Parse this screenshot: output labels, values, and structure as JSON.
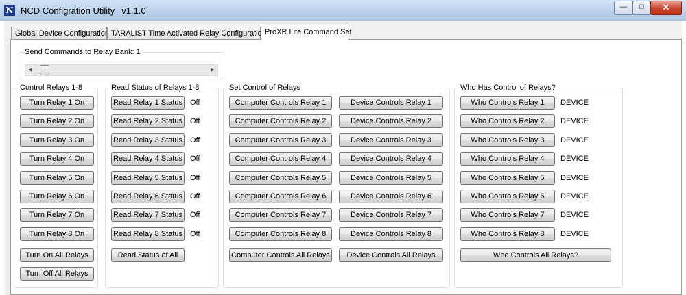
{
  "window": {
    "title": "NCD Configration Utility",
    "version": "v1.1.0",
    "minimize": "—",
    "maximize": "□",
    "close": "✕"
  },
  "tabs": [
    {
      "label": "Global Device Configuration",
      "active": false
    },
    {
      "label": "TARALIST Time Activated Relay Configuration",
      "active": false
    },
    {
      "label": "ProXR Lite Command Set",
      "active": true
    }
  ],
  "bank": {
    "title": "Send Commands to Relay Bank: 1",
    "value": 1,
    "min": 1,
    "max": 32,
    "left_arrow": "◀",
    "right_arrow": "▶"
  },
  "control": {
    "title": "Control Relays 1-8",
    "buttons": [
      "Turn Relay 1 On",
      "Turn Relay 2 On",
      "Turn Relay 3 On",
      "Turn Relay 4 On",
      "Turn Relay 5 On",
      "Turn Relay 6 On",
      "Turn Relay 7 On",
      "Turn Relay 8 On"
    ],
    "all_on": "Turn On All Relays",
    "all_off": "Turn Off All Relays"
  },
  "status": {
    "title": "Read Status of Relays 1-8",
    "buttons": [
      "Read Relay 1 Status",
      "Read Relay 2 Status",
      "Read Relay 3 Status",
      "Read Relay 4 Status",
      "Read Relay 5 Status",
      "Read Relay 6 Status",
      "Read Relay 7 Status",
      "Read Relay 8 Status"
    ],
    "values": [
      "Off",
      "Off",
      "Off",
      "Off",
      "Off",
      "Off",
      "Off",
      "Off"
    ],
    "all": "Read Status of All"
  },
  "set_control": {
    "title": "Set Control of Relays",
    "computer": [
      "Computer Controls Relay 1",
      "Computer Controls Relay 2",
      "Computer Controls Relay 3",
      "Computer Controls Relay 4",
      "Computer Controls Relay 5",
      "Computer Controls Relay 6",
      "Computer Controls Relay 7",
      "Computer Controls Relay 8"
    ],
    "device": [
      "Device Controls Relay 1",
      "Device Controls Relay 2",
      "Device Controls Relay 3",
      "Device Controls Relay 4",
      "Device Controls Relay 5",
      "Device Controls Relay 6",
      "Device Controls Relay 7",
      "Device Controls Relay 8"
    ],
    "computer_all": "Computer Controls All Relays",
    "device_all": "Device Controls All Relays"
  },
  "who": {
    "title": "Who Has Control of Relays?",
    "buttons": [
      "Who Controls Relay 1",
      "Who Controls Relay 2",
      "Who Controls Relay 3",
      "Who Controls Relay 4",
      "Who Controls Relay 5",
      "Who Controls Relay 6",
      "Who Controls Relay 7",
      "Who Controls Relay 8"
    ],
    "values": [
      "DEVICE",
      "DEVICE",
      "DEVICE",
      "DEVICE",
      "DEVICE",
      "DEVICE",
      "DEVICE",
      "DEVICE"
    ],
    "all": "Who Controls All Relays?"
  }
}
